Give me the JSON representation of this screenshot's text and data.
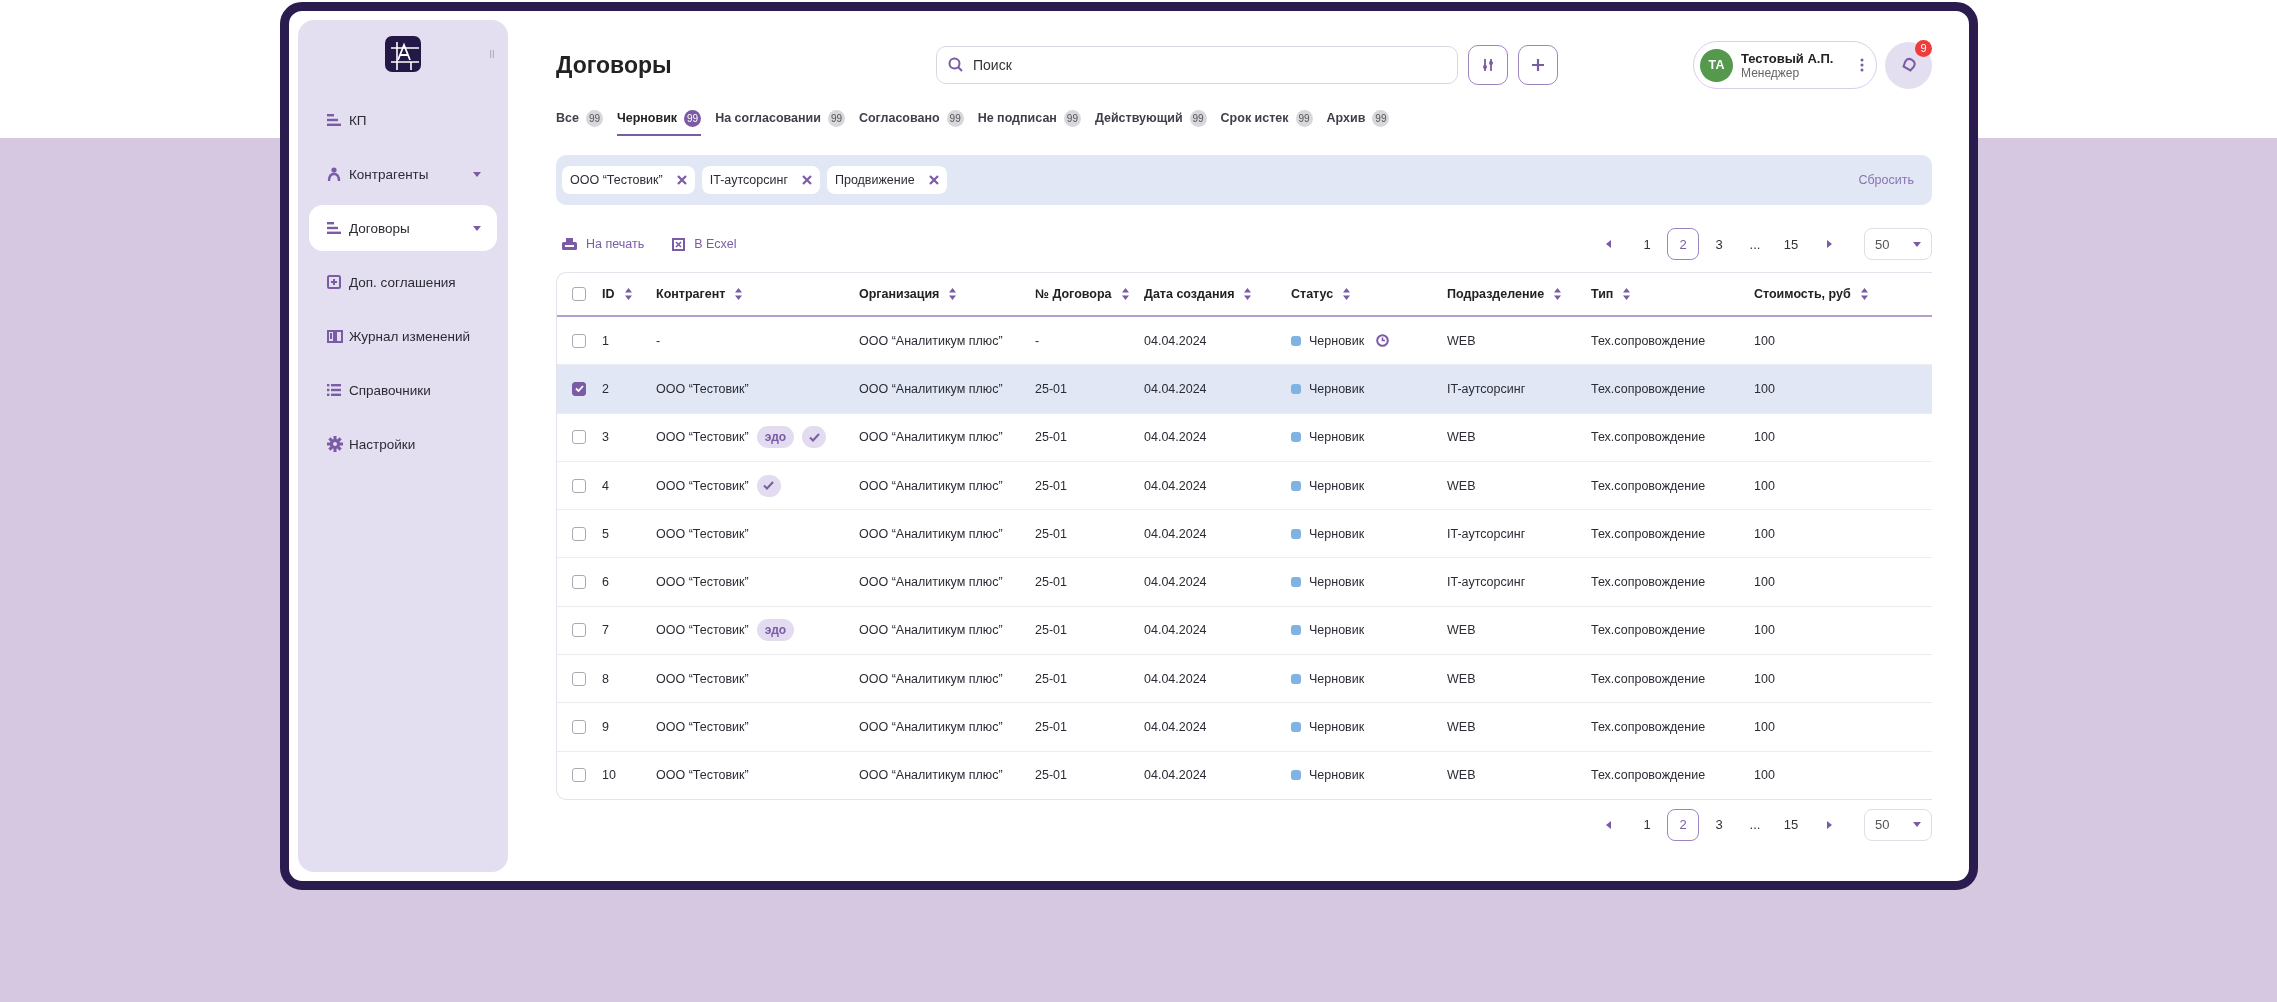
{
  "sidebar": {
    "items": [
      {
        "label": "КП",
        "kind": "lines",
        "expandable": false,
        "selected": false
      },
      {
        "label": "Контрагенты",
        "kind": "person",
        "expandable": true,
        "selected": false
      },
      {
        "label": "Договоры",
        "kind": "lines",
        "expandable": true,
        "selected": true
      },
      {
        "label": "Доп. соглашения",
        "kind": "plus-box",
        "expandable": false,
        "selected": false
      },
      {
        "label": "Журнал изменений",
        "kind": "book",
        "expandable": false,
        "selected": false
      },
      {
        "label": "Справочники",
        "kind": "list",
        "expandable": false,
        "selected": false
      },
      {
        "label": "Настройки",
        "kind": "gear",
        "expandable": false,
        "selected": false
      }
    ]
  },
  "header": {
    "title": "Договоры",
    "search": {
      "placeholder": "Поиск"
    },
    "user": {
      "initials": "ТА",
      "name": "Тестовый А.П.",
      "role": "Менеджер"
    },
    "notifications": "9"
  },
  "tabs": [
    {
      "label": "Все",
      "count": "99",
      "selected": false
    },
    {
      "label": "Черновик",
      "count": "99",
      "selected": true
    },
    {
      "label": "На согласовании",
      "count": "99",
      "selected": false
    },
    {
      "label": "Согласовано",
      "count": "99",
      "selected": false
    },
    {
      "label": "Не подписан",
      "count": "99",
      "selected": false
    },
    {
      "label": "Действующий",
      "count": "99",
      "selected": false
    },
    {
      "label": "Срок истек",
      "count": "99",
      "selected": false
    },
    {
      "label": "Архив",
      "count": "99",
      "selected": false
    }
  ],
  "filters": {
    "chips": [
      "ООО “Тестовик”",
      "IT-аутсорсинг",
      "Продвижение"
    ],
    "reset": "Сбросить"
  },
  "toolbar": {
    "print": "На печать",
    "excel": "В Ecxel"
  },
  "top_pagination": {
    "pages": [
      {
        "label": "1",
        "selected": false
      },
      {
        "label": "2",
        "selected": true
      },
      {
        "label": "3",
        "selected": false
      },
      {
        "label": "...",
        "selected": false
      },
      {
        "label": "15",
        "selected": false
      }
    ],
    "page_size": "50"
  },
  "table": {
    "all_selected": false,
    "columns": [
      "ID",
      "Контрагент",
      "Организация",
      "№ Договора",
      "Дата создания",
      "Статус",
      "Подразделение",
      "Тип",
      "Стоимость, руб"
    ],
    "rows": [
      {
        "selected": false,
        "id": "1",
        "contractor": "-",
        "tags": [],
        "organization": "ООО “Аналитикум плюс”",
        "contract_no": "-",
        "created": "04.04.2024",
        "status": {
          "label": "Черновик",
          "color": "#7fb3e3",
          "timer": true
        },
        "department": "WEB",
        "type": "Тех.сопровождение",
        "cost": "100"
      },
      {
        "selected": true,
        "id": "2",
        "contractor": "ООО “Тестовик”",
        "tags": [],
        "organization": "ООО “Аналитикум плюс”",
        "contract_no": "25-01",
        "created": "04.04.2024",
        "status": {
          "label": "Черновик",
          "color": "#7fb3e3",
          "timer": false
        },
        "department": "IT-аутсорсинг",
        "type": "Тех.сопровождение",
        "cost": "100"
      },
      {
        "selected": false,
        "id": "3",
        "contractor": "ООО “Тестовик”",
        "tags": [
          {
            "kind": "text",
            "label": "эдо"
          },
          {
            "kind": "check"
          }
        ],
        "organization": "ООО “Аналитикум плюс”",
        "contract_no": "25-01",
        "created": "04.04.2024",
        "status": {
          "label": "Черновик",
          "color": "#7fb3e3",
          "timer": false
        },
        "department": "WEB",
        "type": "Тех.сопровождение",
        "cost": "100"
      },
      {
        "selected": false,
        "id": "4",
        "contractor": "ООО “Тестовик”",
        "tags": [
          {
            "kind": "check"
          }
        ],
        "organization": "ООО “Аналитикум плюс”",
        "contract_no": "25-01",
        "created": "04.04.2024",
        "status": {
          "label": "Черновик",
          "color": "#7fb3e3",
          "timer": false
        },
        "department": "WEB",
        "type": "Тех.сопровождение",
        "cost": "100"
      },
      {
        "selected": false,
        "id": "5",
        "contractor": "ООО “Тестовик”",
        "tags": [],
        "organization": "ООО “Аналитикум плюс”",
        "contract_no": "25-01",
        "created": "04.04.2024",
        "status": {
          "label": "Черновик",
          "color": "#7fb3e3",
          "timer": false
        },
        "department": "IT-аутсорсинг",
        "type": "Тех.сопровождение",
        "cost": "100"
      },
      {
        "selected": false,
        "id": "6",
        "contractor": "ООО “Тестовик”",
        "tags": [],
        "organization": "ООО “Аналитикум плюс”",
        "contract_no": "25-01",
        "created": "04.04.2024",
        "status": {
          "label": "Черновик",
          "color": "#7fb3e3",
          "timer": false
        },
        "department": "IT-аутсорсинг",
        "type": "Тех.сопровождение",
        "cost": "100"
      },
      {
        "selected": false,
        "id": "7",
        "contractor": "ООО “Тестовик”",
        "tags": [
          {
            "kind": "text",
            "label": "эдо"
          }
        ],
        "organization": "ООО “Аналитикум плюс”",
        "contract_no": "25-01",
        "created": "04.04.2024",
        "status": {
          "label": "Черновик",
          "color": "#7fb3e3",
          "timer": false
        },
        "department": "WEB",
        "type": "Тех.сопровождение",
        "cost": "100"
      },
      {
        "selected": false,
        "id": "8",
        "contractor": "ООО “Тестовик”",
        "tags": [],
        "organization": "ООО “Аналитикум плюс”",
        "contract_no": "25-01",
        "created": "04.04.2024",
        "status": {
          "label": "Черновик",
          "color": "#7fb3e3",
          "timer": false
        },
        "department": "WEB",
        "type": "Тех.сопровождение",
        "cost": "100"
      },
      {
        "selected": false,
        "id": "9",
        "contractor": "ООО “Тестовик”",
        "tags": [],
        "organization": "ООО “Аналитикум плюс”",
        "contract_no": "25-01",
        "created": "04.04.2024",
        "status": {
          "label": "Черновик",
          "color": "#7fb3e3",
          "timer": false
        },
        "department": "WEB",
        "type": "Тех.сопровождение",
        "cost": "100"
      },
      {
        "selected": false,
        "id": "10",
        "contractor": "ООО “Тестовик”",
        "tags": [],
        "organization": "ООО “Аналитикум плюс”",
        "contract_no": "25-01",
        "created": "04.04.2024",
        "status": {
          "label": "Черновик",
          "color": "#7fb3e3",
          "timer": false
        },
        "department": "WEB",
        "type": "Тех.сопровождение",
        "cost": "100"
      }
    ]
  },
  "bottom_pagination": {
    "pages": [
      {
        "label": "1",
        "selected": false
      },
      {
        "label": "2",
        "selected": true
      },
      {
        "label": "3",
        "selected": false
      },
      {
        "label": "...",
        "selected": false
      },
      {
        "label": "15",
        "selected": false
      }
    ],
    "page_size": "50"
  }
}
